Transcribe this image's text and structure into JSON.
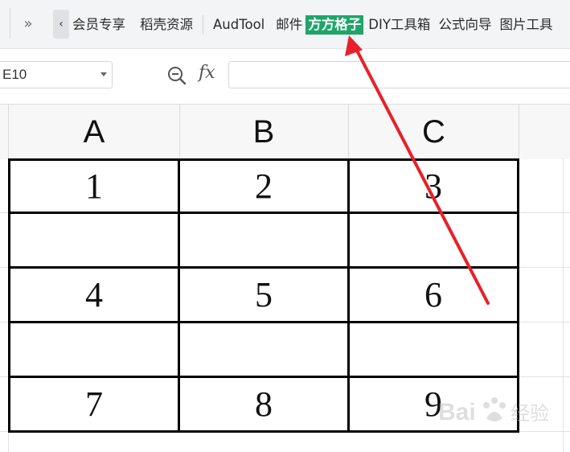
{
  "ribbon": {
    "tabs": [
      {
        "label": "会员专享",
        "cut": true
      },
      {
        "label": "稻壳资源"
      },
      {
        "label": "AudTool"
      },
      {
        "label": "邮件"
      },
      {
        "label": "方方格子",
        "highlighted": true
      },
      {
        "label": "DIY工具箱"
      },
      {
        "label": "公式向导"
      },
      {
        "label": "图片工具"
      }
    ],
    "overflow_icon": "double-chevron-right-icon",
    "scroll_left_icon": "chevron-left-icon"
  },
  "formula_bar": {
    "name_box_value": "E10",
    "zoom_icon": "zoom-out-icon",
    "fx_label": "fx",
    "formula_value": ""
  },
  "sheet": {
    "column_headers": [
      "A",
      "B",
      "C"
    ],
    "rows": [
      [
        "1",
        "2",
        "3"
      ],
      [
        "",
        "",
        ""
      ],
      [
        "4",
        "5",
        "6"
      ],
      [
        "",
        "",
        ""
      ],
      [
        "7",
        "8",
        "9"
      ]
    ]
  },
  "annotation": {
    "arrow_color": "#e8202a",
    "target": "方方格子"
  },
  "colors": {
    "highlight_tab": "#1fa56a",
    "border": "#000000"
  }
}
